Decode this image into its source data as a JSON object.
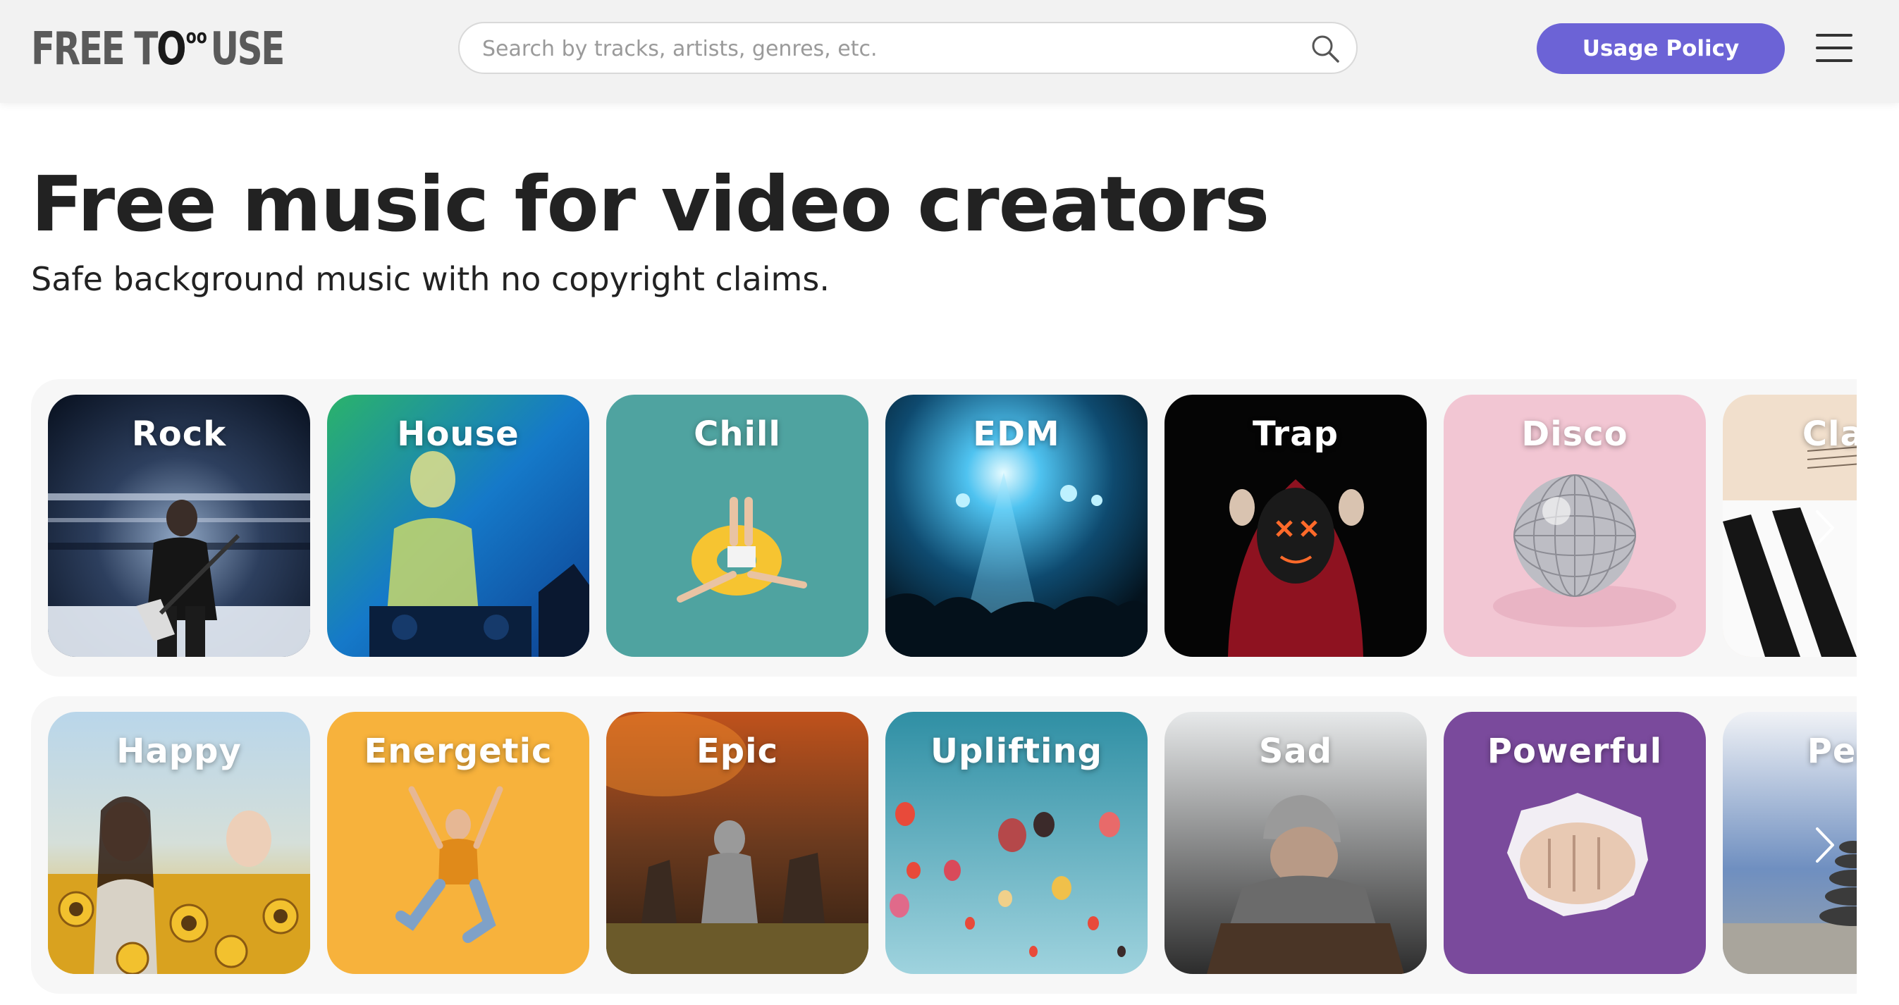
{
  "logo": {
    "part1": "FREE T",
    "zero": "O",
    "superscript": "oo",
    "part2": "USE"
  },
  "search": {
    "placeholder": "Search by tracks, artists, genres, etc."
  },
  "header": {
    "usage_policy_label": "Usage Policy"
  },
  "hero": {
    "title": "Free music for video creators",
    "subtitle": "Safe background music with no copyright claims."
  },
  "genres": [
    {
      "label": "Rock"
    },
    {
      "label": "House"
    },
    {
      "label": "Chill"
    },
    {
      "label": "EDM"
    },
    {
      "label": "Trap"
    },
    {
      "label": "Disco"
    },
    {
      "label": "Class"
    }
  ],
  "moods": [
    {
      "label": "Happy"
    },
    {
      "label": "Energetic"
    },
    {
      "label": "Epic"
    },
    {
      "label": "Uplifting"
    },
    {
      "label": "Sad"
    },
    {
      "label": "Powerful"
    },
    {
      "label": "Peac"
    }
  ],
  "colors": {
    "accent": "#6c63d6",
    "header_bg": "#f2f2f2",
    "text": "#222222"
  },
  "icons": {
    "search": "search-icon",
    "menu": "hamburger-menu-icon",
    "next": "chevron-right-icon"
  }
}
